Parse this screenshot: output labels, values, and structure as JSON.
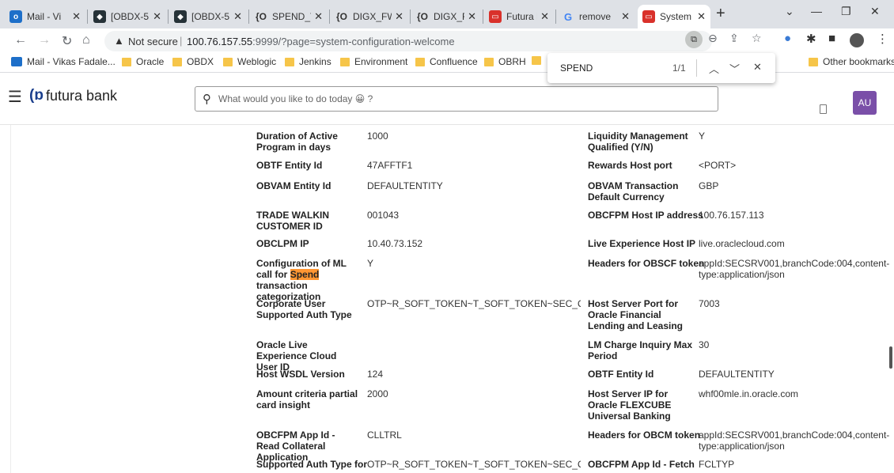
{
  "tabs": [
    {
      "title": "Mail - Vi",
      "favicon": "outlook-icon"
    },
    {
      "title": "[OBDX-5",
      "favicon": "obdx-icon"
    },
    {
      "title": "[OBDX-5",
      "favicon": "obdx-icon"
    },
    {
      "title": "SPEND_T",
      "favicon": "json-icon"
    },
    {
      "title": "DIGX_FW",
      "favicon": "json-icon"
    },
    {
      "title": "DIGX_FW",
      "favicon": "json-icon"
    },
    {
      "title": "Futura B",
      "favicon": "oracle-icon"
    },
    {
      "title": "remove",
      "favicon": "google-icon"
    },
    {
      "title": "System C",
      "favicon": "oracle-icon"
    }
  ],
  "address_bar": {
    "security_text": "Not secure",
    "url_host": "100.76.157.55",
    "url_rest": ":9999/?page=system-configuration-welcome"
  },
  "bookmarks": {
    "items": [
      "Mail - Vikas Fadale...",
      "Oracle",
      "OBDX",
      "Weblogic",
      "Jenkins",
      "Environment",
      "Confluence",
      "OBRH"
    ],
    "other": "Other bookmarks"
  },
  "find_bar": {
    "query": "SPEND",
    "count": "1/1"
  },
  "app": {
    "brand": "futura bank",
    "search_placeholder": "What would you like to do today 😀 ?",
    "avatar_initials": "AU"
  },
  "left_fields": [
    {
      "label": "Duration of Active Program in days",
      "value": "1000"
    },
    {
      "label": "OBTF Entity Id",
      "value": "47AFFTF1"
    },
    {
      "label": "OBVAM Entity Id",
      "value": "DEFAULTENTITY"
    },
    {
      "label": "TRADE WALKIN CUSTOMER ID",
      "value": "001043"
    },
    {
      "label": "OBCLPM IP",
      "value": "10.40.73.152"
    },
    {
      "label_before": "Configuration of ML call for ",
      "label_highlight": "Spend",
      "label_after": " transaction categorization",
      "value": "Y"
    },
    {
      "label": "Corporate User Supported Auth Type",
      "value": "OTP~R_SOFT_TOKEN~T_SOFT_TOKEN~SEC_QUE~PUSH~SMS"
    },
    {
      "label": "Oracle Live Experience Cloud User ID",
      "value": ""
    },
    {
      "label": "Host WSDL Version",
      "value": "124"
    },
    {
      "label": "Amount criteria partial card insight",
      "value": "2000"
    },
    {
      "label": "OBCFPM App Id - Read Collateral Application",
      "value": "CLLTRL"
    },
    {
      "label": "Supported Auth Type for",
      "value": "OTP~R_SOFT_TOKEN~T_SOFT_TOKEN~SEC_QUE~PUSH~SMS"
    }
  ],
  "right_fields": [
    {
      "label": "Liquidity Management Qualified (Y/N)",
      "value": "Y"
    },
    {
      "label": "Rewards Host port",
      "value": "<PORT>"
    },
    {
      "label": "OBVAM Transaction Default Currency",
      "value": "GBP"
    },
    {
      "label": "OBCFPM Host IP address",
      "value": "100.76.157.113"
    },
    {
      "label": "Live Experience Host IP",
      "value": "live.oraclecloud.com"
    },
    {
      "label": "Headers for OBSCF token",
      "value": "appId:SECSRV001,branchCode:004,content-type:application/json"
    },
    {
      "label": "Host Server Port for Oracle Financial Lending and Leasing",
      "value": "7003"
    },
    {
      "label": "LM Charge Inquiry Max Period",
      "value": "30"
    },
    {
      "label": "OBTF Entity Id",
      "value": "DEFAULTENTITY"
    },
    {
      "label": "Host Server IP for Oracle FLEXCUBE Universal Banking",
      "value": "whf00mle.in.oracle.com"
    },
    {
      "label": "Headers for OBCM token",
      "value": "appId:SECSRV001,branchCode:004,content-type:application/json"
    },
    {
      "label": "OBCFPM App Id - Fetch",
      "value": "FCLTYP"
    }
  ]
}
